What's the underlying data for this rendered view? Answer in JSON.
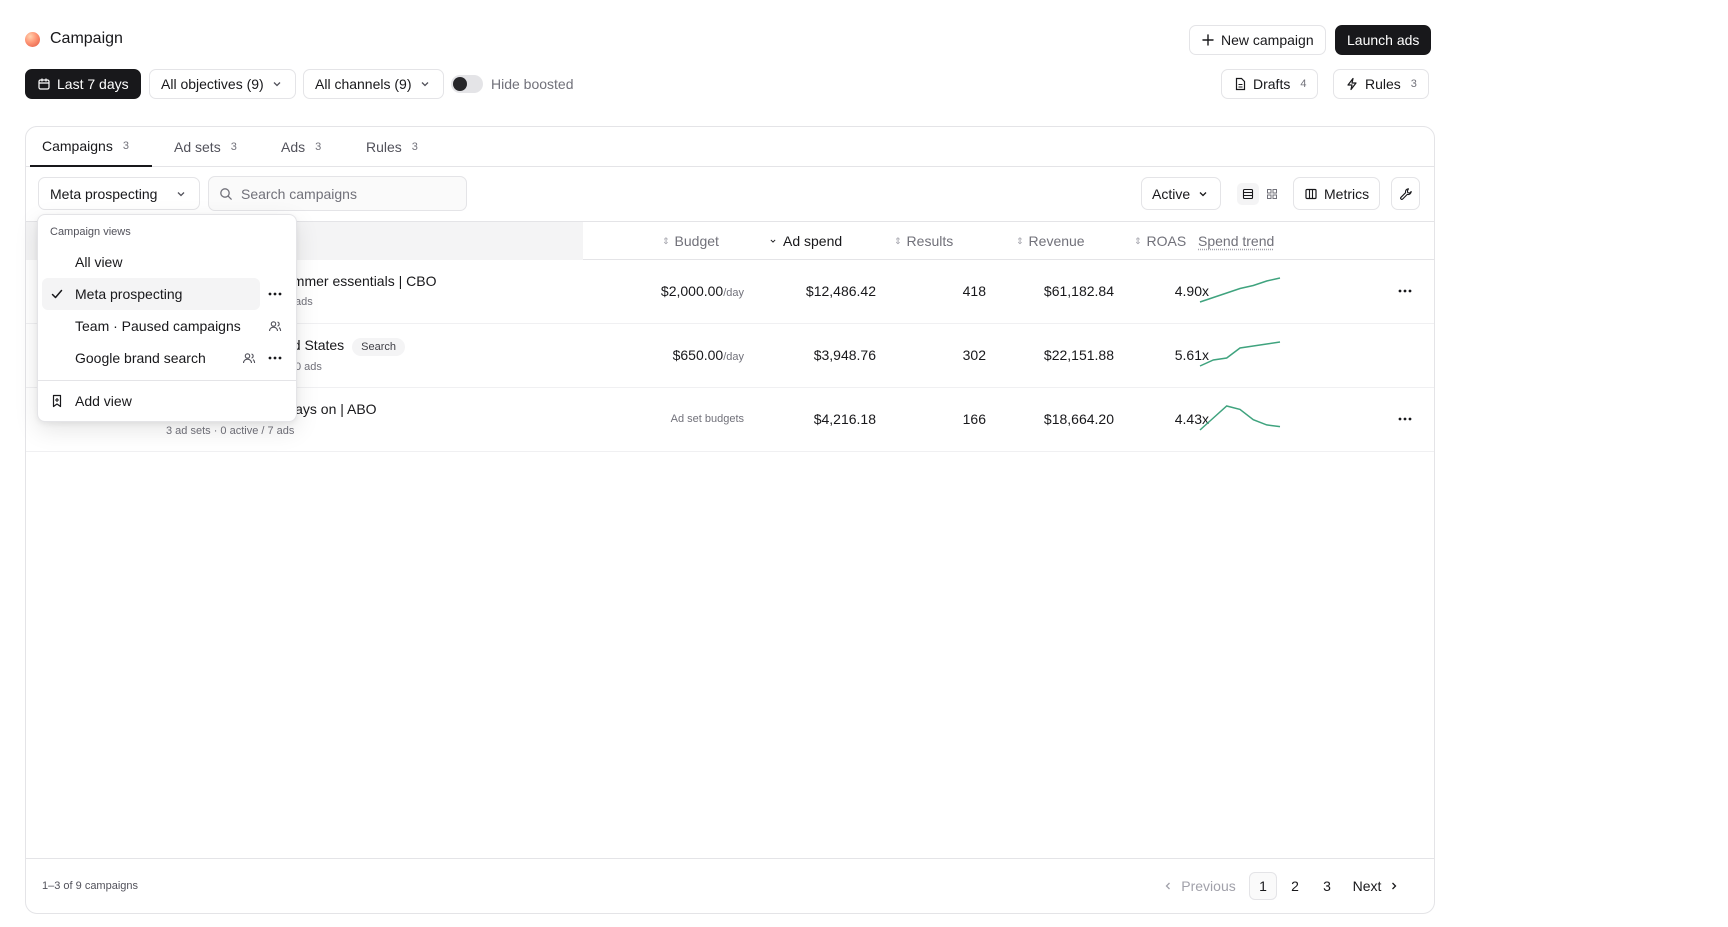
{
  "app": {
    "title": "Campaign"
  },
  "header": {
    "new_campaign": "New campaign",
    "launch_ads": "Launch ads",
    "date_range": "Last 7 days",
    "objectives": "All objectives (9)",
    "channels": "All channels (9)",
    "hide_boosted": "Hide boosted",
    "hide_boosted_on": false,
    "drafts": {
      "label": "Drafts",
      "count": "4"
    },
    "rules": {
      "label": "Rules",
      "count": "3"
    }
  },
  "tabs": [
    {
      "label": "Campaigns",
      "count": "3",
      "active": true
    },
    {
      "label": "Ad sets",
      "count": "3"
    },
    {
      "label": "Ads",
      "count": "3"
    },
    {
      "label": "Rules",
      "count": "3"
    }
  ],
  "toolbar": {
    "view": "Meta prospecting",
    "search_placeholder": "Search campaigns",
    "status": "Active",
    "metrics": "Metrics"
  },
  "columns": {
    "budget": "Budget",
    "ad_spend": "Ad spend",
    "results": "Results",
    "revenue": "Revenue",
    "roas": "ROAS",
    "spend_trend": "Spend trend"
  },
  "rows": [
    {
      "name": "ummer essentials | CBO",
      "sub": "ads",
      "budget": "$2,000.00",
      "budget_per": "/day",
      "spend": "$12,486.42",
      "results": "418",
      "revenue": "$61,182.84",
      "roas": "4.90x",
      "trend": [
        2,
        5,
        8,
        11,
        13,
        16,
        18
      ]
    },
    {
      "name": "ed States",
      "badge": "Search",
      "sub": "0 ads",
      "budget": "$650.00",
      "budget_per": "/day",
      "spend": "$3,948.76",
      "results": "302",
      "revenue": "$22,151.88",
      "roas": "5.61x",
      "trend": [
        3,
        6,
        7,
        12,
        13,
        14,
        15
      ]
    },
    {
      "name": "ways on | ABO",
      "sub": "3 ad sets · 0 active / 7 ads",
      "budget_note": "Ad set budgets",
      "spend": "$4,216.18",
      "results": "166",
      "revenue": "$18,664.20",
      "roas": "4.43x",
      "trend": [
        3,
        10,
        17,
        15,
        9,
        6,
        5
      ]
    }
  ],
  "footer": {
    "count": "1–3 of 9 campaigns",
    "previous": "Previous",
    "next": "Next",
    "pages": [
      "1",
      "2",
      "3"
    ],
    "current": "1"
  },
  "dropdown": {
    "heading": "Campaign views",
    "items": [
      {
        "label": "All view"
      },
      {
        "label": "Meta prospecting",
        "selected": true,
        "icon": "more-icon"
      },
      {
        "label": "Team · Paused campaigns",
        "icon": "users-icon"
      },
      {
        "label": "Google brand search",
        "icon": "users-icon"
      }
    ],
    "add_view": "Add view"
  },
  "colors": {
    "accent": "#18181b",
    "trend": "#3fa37e",
    "meta_blue": "#1877f2"
  }
}
